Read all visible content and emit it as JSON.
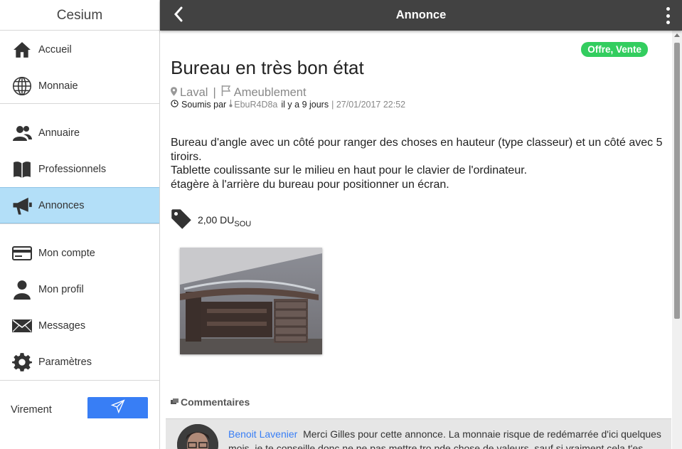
{
  "app": {
    "name": "Cesium"
  },
  "sidebar": {
    "items": [
      {
        "label": "Accueil",
        "icon": "home-icon"
      },
      {
        "label": "Monnaie",
        "icon": "globe-icon"
      },
      {
        "label": "Annuaire",
        "icon": "users-icon"
      },
      {
        "label": "Professionnels",
        "icon": "book-icon"
      },
      {
        "label": "Annonces",
        "icon": "megaphone-icon",
        "active": true
      },
      {
        "label": "Mon compte",
        "icon": "card-icon"
      },
      {
        "label": "Mon profil",
        "icon": "person-icon"
      },
      {
        "label": "Messages",
        "icon": "mail-icon"
      },
      {
        "label": "Paramètres",
        "icon": "gear-icon"
      }
    ],
    "virement_label": "Virement",
    "active_color": "#b3dff8"
  },
  "header": {
    "title": "Annonce",
    "bg_color": "#424242"
  },
  "ad": {
    "badge": "Offre, Vente",
    "badge_color": "#33cd5f",
    "title": "Bureau en très bon état",
    "location": "Laval",
    "category": "Ameublement",
    "submitted_prefix": "Soumis par",
    "author_key": "EbuR4D8a",
    "age": "il y a 9 jours",
    "date": "| 27/01/2017 22:52",
    "description": [
      "Bureau d'angle avec un côté pour ranger des choses en hauteur (type classeur) et un côté avec 5 tiroirs.",
      "Tablette coulissante sur le milieu en haut pour le clavier de l'ordinateur.",
      "étagère à l'arrière du bureau pour positionner un écran."
    ],
    "price_value": "2,00 DU",
    "price_unit": "SOU"
  },
  "comments": {
    "title": "Commentaires",
    "items": [
      {
        "author": "Benoit Lavenier",
        "text": "Merci Gilles pour cette annonce. La monnaie risque de redémarrée d'ici quelques mois, je te conseille donc ne ne pas mettre tro pde chose de valeurs, sauf si vraiment cela t'es égal"
      }
    ]
  }
}
